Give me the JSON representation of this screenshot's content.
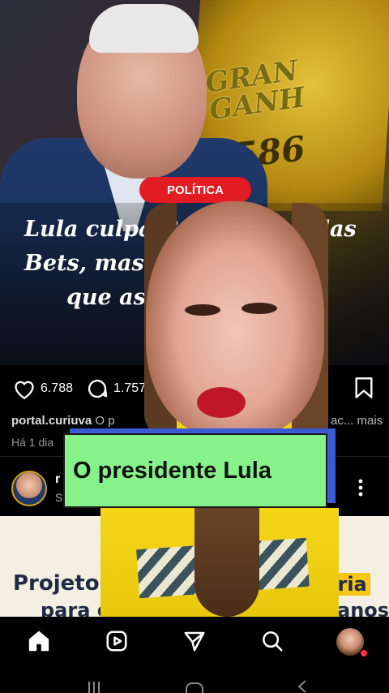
{
  "post1": {
    "tag": "POLÍTICA",
    "headline_lines": [
      "Lula culpa B",
      "pelas",
      "Bets, mas",
      "rno",
      "que as r"
    ],
    "slot_text_line1": "GRAN",
    "slot_text_line2": "GANH",
    "slot_number": "8.586",
    "likes": "6.788",
    "comments": "1.757",
    "caption_user": "portal.curiuva",
    "caption_preview": "O p",
    "caption_truncated": "ac...",
    "caption_more": "mais",
    "time": "Há 1 dia"
  },
  "post2": {
    "user": "r",
    "sub": "S",
    "title_line1": "Projeto d",
    "title_line1_right": "ória",
    "title_line2": "para carros com mais de 5 anos"
  },
  "overlay": {
    "caption": "O presidente Lula",
    "caption_bg": "#86f28a",
    "caption_shadow": "#3a5ad6"
  },
  "nav": {
    "items": [
      "home-icon",
      "reels-icon",
      "direct-icon",
      "search-icon",
      "profile-avatar"
    ]
  },
  "colors": {
    "tag_red": "#e31b23",
    "notification_dot": "#ff3040"
  }
}
